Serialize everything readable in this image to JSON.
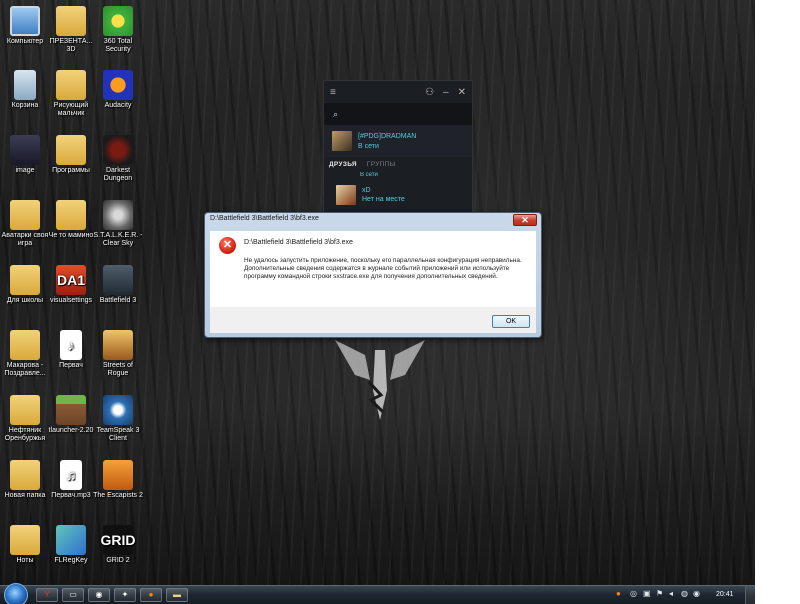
{
  "desktop_icons": [
    {
      "label": "Компьютер",
      "icon": "computer-icon"
    },
    {
      "label": "ПРЕЗЕНТА... 3D",
      "icon": "folder-icon"
    },
    {
      "label": "360 Total Security",
      "icon": "360-security-icon"
    },
    {
      "label": "Корзина",
      "icon": "recycle-bin-icon"
    },
    {
      "label": "Рисующий мальчик",
      "icon": "folder-icon"
    },
    {
      "label": "Audacity",
      "icon": "audacity-icon"
    },
    {
      "label": "image",
      "icon": "image-icon"
    },
    {
      "label": "Программы",
      "icon": "folder-icon"
    },
    {
      "label": "Darkest Dungeon",
      "icon": "darkest-dungeon-icon"
    },
    {
      "label": "Аватарки своя игра",
      "icon": "folder-icon"
    },
    {
      "label": "Че то мамино",
      "icon": "folder-icon"
    },
    {
      "label": "S.T.A.L.K.E.R. - Clear Sky",
      "icon": "stalker-icon"
    },
    {
      "label": "Для школы",
      "icon": "folder-icon"
    },
    {
      "label": "visualsettings",
      "icon": "settings-app-icon"
    },
    {
      "label": "Battlefield 3",
      "icon": "battlefield-icon"
    },
    {
      "label": "Макарова - Поздравле...",
      "icon": "folder-icon"
    },
    {
      "label": "Первач",
      "icon": "mp3-file-icon"
    },
    {
      "label": "Streets of Rogue",
      "icon": "streets-of-rogue-icon"
    },
    {
      "label": "Нефтяник Оренбуржья",
      "icon": "folder-icon"
    },
    {
      "label": "tlauncher-2.20",
      "icon": "minecraft-icon"
    },
    {
      "label": "TeamSpeak 3 Client",
      "icon": "teamspeak-icon"
    },
    {
      "label": "Новая папка",
      "icon": "folder-icon"
    },
    {
      "label": "Первач.mp3",
      "icon": "mp3-file-icon"
    },
    {
      "label": "The Escapists 2",
      "icon": "escapists-icon"
    },
    {
      "label": "Ноты",
      "icon": "folder-icon"
    },
    {
      "label": "FLRegKey",
      "icon": "key-app-icon"
    },
    {
      "label": "GRID 2",
      "icon": "grid2-icon"
    }
  ],
  "steam": {
    "search_glyph": "⌕",
    "user_name": "[#PDG]DRADMAN",
    "user_status": "В сети",
    "tab_friends": "ДРУЗЬЯ",
    "tab_groups": "ГРУППЫ",
    "partial_status": "В сети",
    "friend_name": "xD",
    "friend_status": "Нет на месте"
  },
  "dialog": {
    "title": "D:\\Battlefield 3\\Battlefield 3\\bf3.exe",
    "path": "D:\\Battlefield 3\\Battlefield 3\\bf3.exe",
    "message": "Не удалось запустить приложение, поскольку его параллельная конфигурация неправильна. Дополнительные сведения содержатся в журнале событий приложений или используйте программу командной строки sxstrace.exe для получения дополнительных сведений.",
    "ok_label": "OK",
    "close_glyph": "✕",
    "error_glyph": "✕"
  },
  "taskbar": {
    "clock": "20:41"
  },
  "colors": {
    "steam_accent": "#57cbde",
    "error_red": "#d42415",
    "dialog_frame": "#c9d9ea"
  }
}
